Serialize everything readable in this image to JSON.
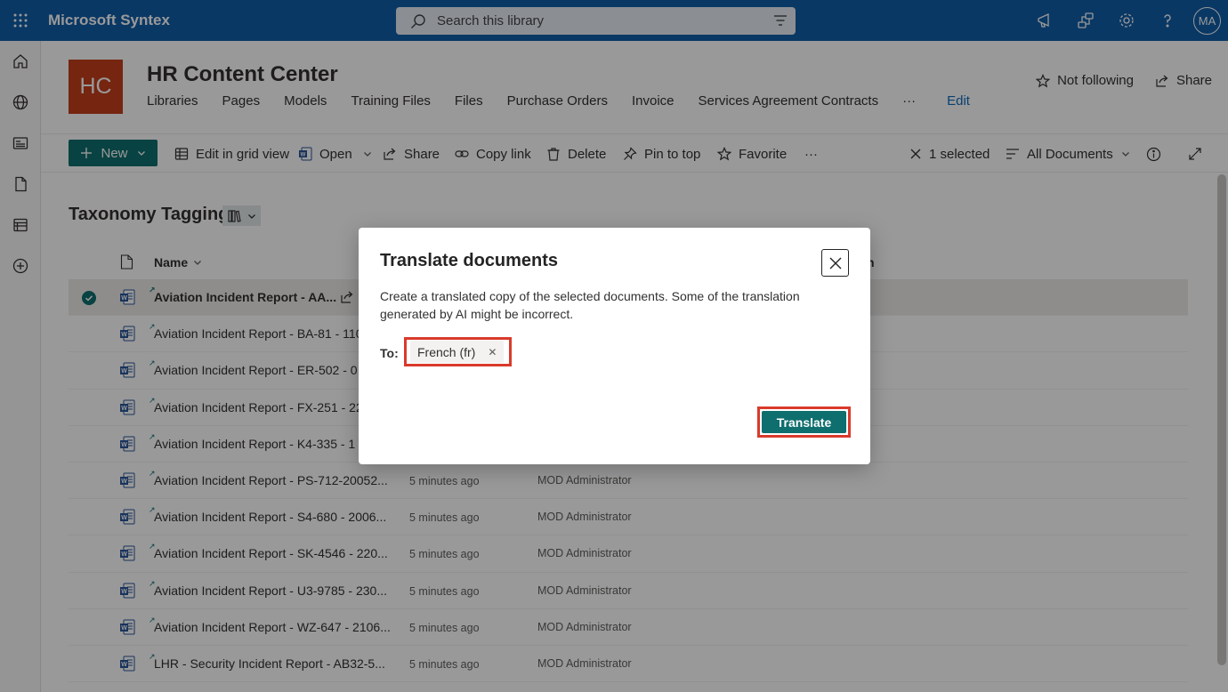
{
  "app": {
    "title": "Microsoft Syntex",
    "search_placeholder": "Search this library",
    "avatar_initials": "MA"
  },
  "site": {
    "logo_text": "HC",
    "title": "HR Content Center",
    "nav": [
      "Libraries",
      "Pages",
      "Models",
      "Training Files",
      "Files",
      "Purchase Orders",
      "Invoice",
      "Services Agreement Contracts"
    ],
    "nav_more": "···",
    "edit_label": "Edit",
    "follow_label": "Not following",
    "share_label": "Share"
  },
  "commands": {
    "new_label": "New",
    "grid_label": "Edit in grid view",
    "open_label": "Open",
    "share_label": "Share",
    "copy_link_label": "Copy link",
    "delete_label": "Delete",
    "pin_label": "Pin to top",
    "favorite_label": "Favorite",
    "more_label": "···",
    "selected_label": "1 selected",
    "view_label": "All Documents"
  },
  "view": {
    "title": "Taxonomy Tagging",
    "name_header": "Name",
    "partial_header": "n"
  },
  "rows": [
    {
      "name": "Aviation Incident Report - AA...",
      "modified": "",
      "by": "",
      "selected": true
    },
    {
      "name": "Aviation Incident Report - BA-81 - 110",
      "modified": "",
      "by": ""
    },
    {
      "name": "Aviation Incident Report - ER-502 - 0",
      "modified": "",
      "by": ""
    },
    {
      "name": "Aviation Incident Report - FX-251 - 22",
      "modified": "",
      "by": ""
    },
    {
      "name": "Aviation Incident Report - K4-335 - 1",
      "modified": "",
      "by": ""
    },
    {
      "name": "Aviation Incident Report - PS-712-20052...",
      "modified": "5 minutes ago",
      "by": "MOD Administrator"
    },
    {
      "name": "Aviation Incident Report - S4-680 - 2006...",
      "modified": "5 minutes ago",
      "by": "MOD Administrator"
    },
    {
      "name": "Aviation Incident Report - SK-4546 - 220...",
      "modified": "5 minutes ago",
      "by": "MOD Administrator"
    },
    {
      "name": "Aviation Incident Report - U3-9785 - 230...",
      "modified": "5 minutes ago",
      "by": "MOD Administrator"
    },
    {
      "name": "Aviation Incident Report - WZ-647 - 2106...",
      "modified": "5 minutes ago",
      "by": "MOD Administrator"
    },
    {
      "name": "LHR - Security Incident Report - AB32-5...",
      "modified": "5 minutes ago",
      "by": "MOD Administrator"
    }
  ],
  "dialog": {
    "title": "Translate documents",
    "description": "Create a translated copy of the selected documents. Some of the translation generated by AI might be incorrect.",
    "to_label": "To:",
    "language": "French (fr)",
    "translate_label": "Translate"
  },
  "colors": {
    "topbar": "#0f5ea8",
    "accent": "#0f6e6e",
    "site_logo": "#c43e1c",
    "highlight": "#d93a2b"
  }
}
